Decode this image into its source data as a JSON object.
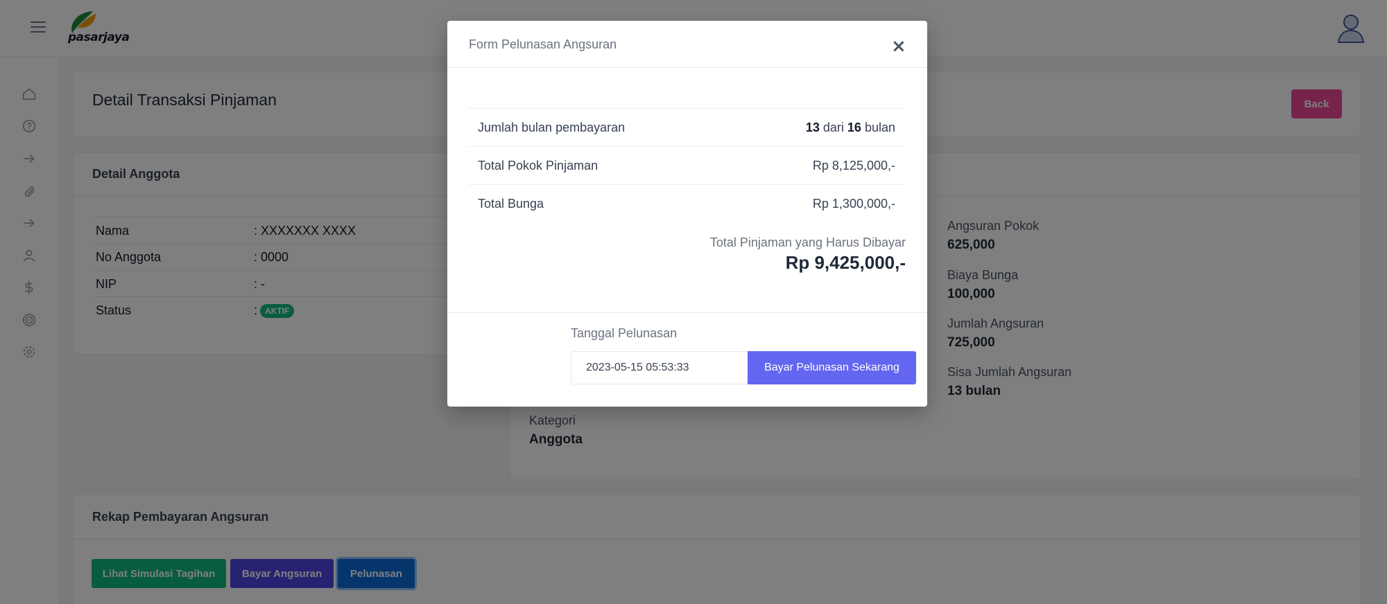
{
  "header": {
    "logo_text": "pasarjaya"
  },
  "page": {
    "title": "Detail Transaksi Pinjaman",
    "back_label": "Back"
  },
  "member": {
    "section_title": "Detail Anggota",
    "rows": [
      {
        "label": "Nama",
        "value": ": XXXXXXX XXXX"
      },
      {
        "label": "No Anggota",
        "value": ": 0000"
      },
      {
        "label": "NIP",
        "value": ": -"
      },
      {
        "label": "Status",
        "value": ":"
      }
    ],
    "status_badge": "AKTIF"
  },
  "loan_stats": [
    {
      "label": "Angsuran Pokok",
      "value": "625,000"
    },
    {
      "label": "Biaya Bunga",
      "value": "100,000"
    },
    {
      "label": "Jumlah Angsuran",
      "value": "725,000"
    },
    {
      "label": "Sisa Jumlah Angsuran",
      "value": "13 bulan"
    }
  ],
  "category": {
    "label": "Kategori",
    "value": "Anggota"
  },
  "rekap": {
    "section_title": "Rekap Pembayaran Angsuran",
    "buttons": {
      "simulasi": "Lihat Simulasi Tagihan",
      "bayar": "Bayar Angsuran",
      "pelunasan": "Pelunasan"
    }
  },
  "modal": {
    "title": "Form Pelunasan Angsuran",
    "close_glyph": "×",
    "rows": {
      "months_label": "Jumlah bulan pembayaran",
      "months_paid": "13",
      "months_sep": "dari",
      "months_total": "16",
      "months_unit": "bulan",
      "pokok_label": "Total Pokok Pinjaman",
      "pokok_value": "Rp 8,125,000,-",
      "bunga_label": "Total Bunga",
      "bunga_value": "Rp 1,300,000,-"
    },
    "total_label": "Total Pinjaman yang Harus Dibayar",
    "total_value": "Rp 9,425,000,-",
    "date_label": "Tanggal Pelunasan",
    "date_value": "2023-05-15 05:53:33",
    "pay_label": "Bayar Pelunasan Sekarang"
  },
  "colors": {
    "primary": "#6366f1",
    "success": "#10b981",
    "danger": "#ec4899",
    "indigo": "#4f46e5",
    "blue": "#0b6bd6"
  }
}
